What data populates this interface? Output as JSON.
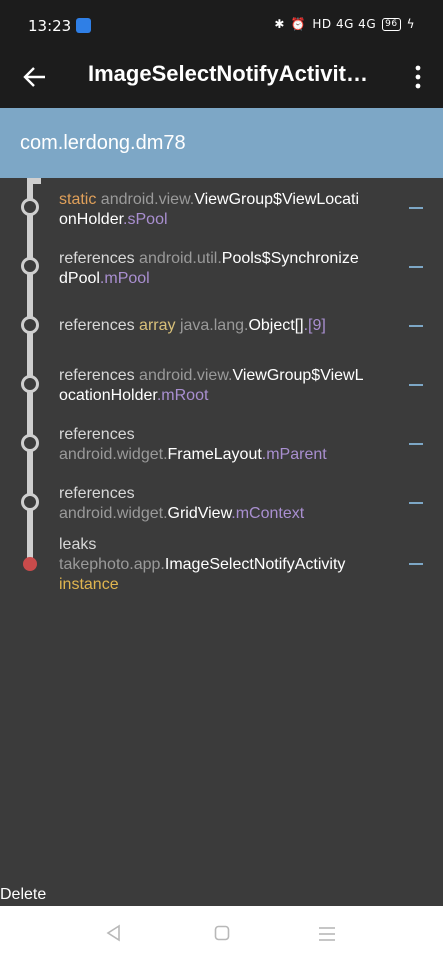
{
  "status": {
    "time": "13:23",
    "network": "HD 4G 4G",
    "battery": "96"
  },
  "appbar": {
    "title": "ImageSelectNotifyActivit…"
  },
  "header": {
    "package": "com.lerdong.dm78"
  },
  "trace": [
    {
      "prefix": "static",
      "pkg": "android.view.",
      "cls_line1": "ViewGroup$ViewLocati",
      "cls_line2": "onHolder",
      "field": ".sPool"
    },
    {
      "prefix": "references",
      "pkg": "android.util.",
      "cls_line1": "Pools$Synchronize",
      "cls_line2": "dPool",
      "field": ".mPool"
    },
    {
      "prefix": "references",
      "kw": "array",
      "pkg": "java.lang.",
      "cls": "Object[]",
      "field": ".[9]"
    },
    {
      "prefix": "references",
      "pkg": "android.view.",
      "cls_line1": "ViewGroup$ViewL",
      "cls_line2": "ocationHolder",
      "field": ".mRoot"
    },
    {
      "prefix": "references",
      "pkg": "android.widget.",
      "cls": "FrameLayout",
      "field": ".mParent"
    },
    {
      "prefix": "references",
      "pkg": "android.widget.",
      "cls": "GridView",
      "field": ".mContext"
    },
    {
      "prefix": "leaks",
      "pkg": "takephoto.app.",
      "cls": "ImageSelectNotifyActivity",
      "instance": "instance"
    }
  ],
  "footer": {
    "delete_label": "Delete"
  },
  "colors": {
    "header_bg": "#7da7c6",
    "bar_bg": "#1c1c1c",
    "list_bg": "#3b3b3b",
    "leak_dot": "#c94b4b"
  },
  "icons": [
    "back-arrow-icon",
    "more-vert-icon",
    "nav-back-icon",
    "nav-home-icon",
    "nav-menu-icon"
  ]
}
